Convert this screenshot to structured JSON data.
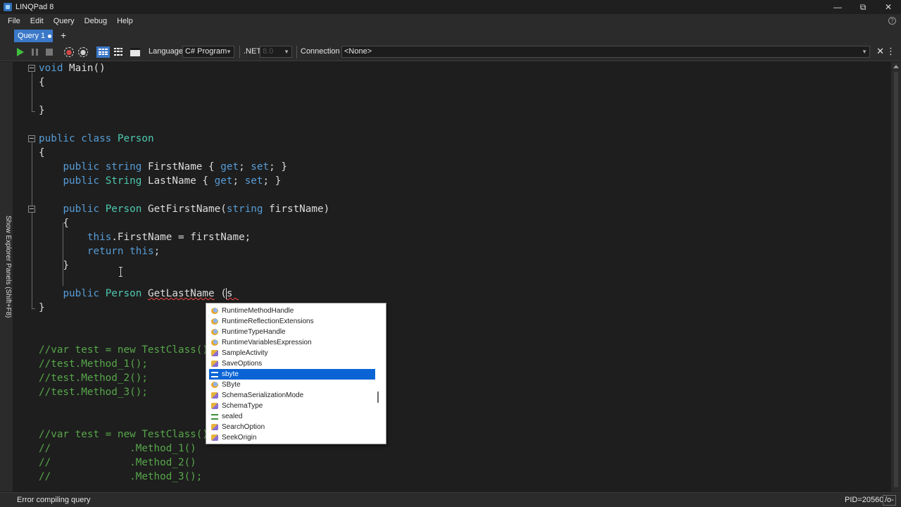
{
  "window": {
    "title": "LINQPad 8",
    "minimize_glyph": "—",
    "restore_glyph": "⧉",
    "close_glyph": "✕"
  },
  "menu": [
    "File",
    "Edit",
    "Query",
    "Debug",
    "Help"
  ],
  "help_glyph": "?",
  "tabs": [
    {
      "label": "Query 1",
      "modified": true
    }
  ],
  "tab_add_glyph": "+",
  "toolbar": {
    "language_label": "Language",
    "language_value": "C# Program",
    "net_label": ".NET",
    "net_value": "8.0",
    "connection_label": "Connection",
    "connection_value": "<None>",
    "close_glyph": "✕",
    "menu_glyph": "⋮"
  },
  "side_panel": {
    "label": "Show Explorer Panels (Shift+F8)"
  },
  "editor": {
    "lines": [
      "void Main()",
      "{",
      "}",
      "public class Person",
      "{",
      "public string FirstName { get; set; }",
      "public String LastName { get; set; }",
      "public Person GetFirstName(string firstName)",
      "{",
      "this.FirstName = firstName;",
      "return this;",
      "}",
      "public Person GetLastName (s",
      "}",
      "//var test = new TestClass();",
      "//test.Method_1();",
      "//test.Method_2();",
      "//test.Method_3();",
      "//var test = new TestClass()",
      "//             .Method_1()",
      "//             .Method_2()",
      "//             .Method_3();"
    ]
  },
  "autocomplete": {
    "items": [
      {
        "label": "RuntimeMethodHandle",
        "icon": "struct-icon"
      },
      {
        "label": "RuntimeReflectionExtensions",
        "icon": "class-icon"
      },
      {
        "label": "RuntimeTypeHandle",
        "icon": "struct-icon"
      },
      {
        "label": "RuntimeVariablesExpression",
        "icon": "class-icon"
      },
      {
        "label": "SampleActivity",
        "icon": "delegate-icon"
      },
      {
        "label": "SaveOptions",
        "icon": "enum-icon"
      },
      {
        "label": "sbyte",
        "icon": "keyword-icon",
        "selected": true
      },
      {
        "label": "SByte",
        "icon": "struct-icon"
      },
      {
        "label": "SchemaSerializationMode",
        "icon": "enum-icon"
      },
      {
        "label": "SchemaType",
        "icon": "enum-icon"
      },
      {
        "label": "sealed",
        "icon": "keyword-icon"
      },
      {
        "label": "SearchOption",
        "icon": "enum-icon"
      },
      {
        "label": "SeekOrigin",
        "icon": "enum-icon"
      }
    ]
  },
  "status": {
    "message": "Error compiling query",
    "pid": "PID=20560",
    "optimize": "/o-"
  },
  "colors": {
    "keyword": "#569cd6",
    "type": "#4ec9b0",
    "comment": "#57a64a",
    "accent": "#3b78c8",
    "selection": "#0a64d6"
  }
}
